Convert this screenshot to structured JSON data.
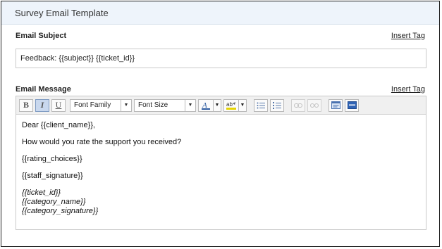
{
  "header": {
    "title": "Survey Email Template"
  },
  "subject": {
    "label": "Email Subject",
    "insert_tag": "Insert Tag",
    "value": "Feedback: {{subject}} {{ticket_id}}"
  },
  "message": {
    "label": "Email Message",
    "insert_tag": "Insert Tag",
    "toolbar": {
      "bold": "B",
      "italic": "I",
      "underline": "U",
      "font_family": "Font Family",
      "font_size": "Font Size"
    },
    "lines": [
      "Dear {{client_name}},",
      "How would you rate the support you received?",
      "{{rating_choices}}",
      "{{staff_signature}}"
    ],
    "italic_lines": [
      "{{ticket_id}}",
      "{{category_name}}",
      "{{category_signature}}"
    ]
  }
}
